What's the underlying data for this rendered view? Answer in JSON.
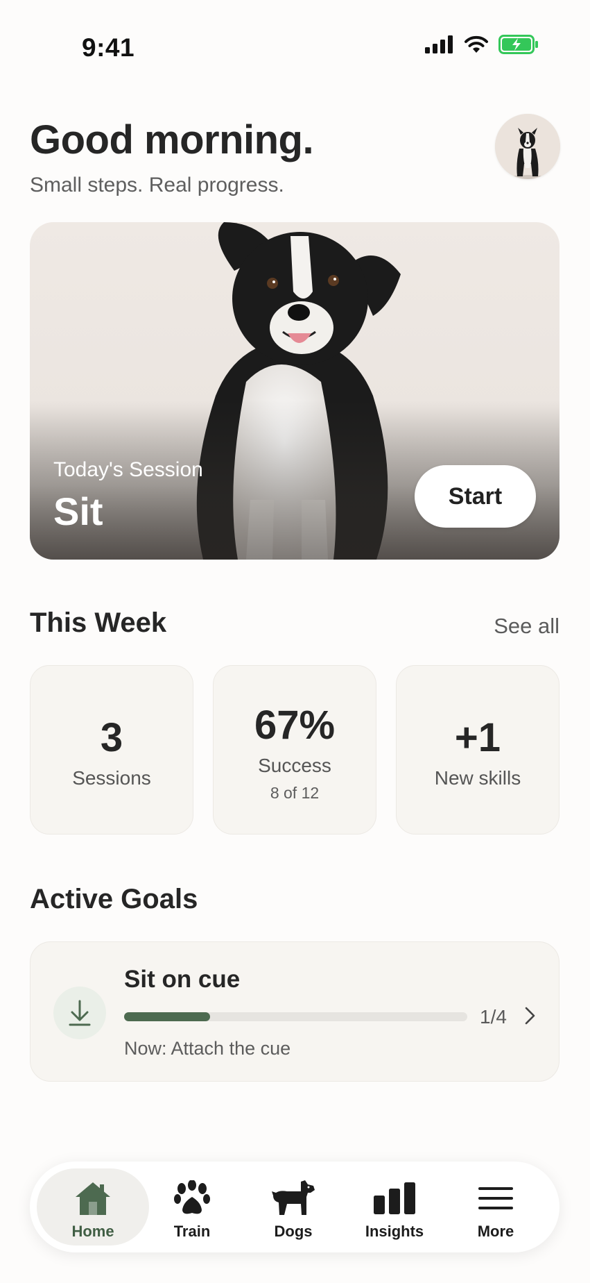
{
  "status_bar": {
    "time": "9:41"
  },
  "header": {
    "greeting": "Good morning.",
    "tagline": "Small steps. Real progress."
  },
  "hero": {
    "subtitle": "Today's Session",
    "title": "Sit",
    "start_label": "Start"
  },
  "this_week": {
    "title": "This Week",
    "see_all": "See all",
    "stats": [
      {
        "value": "3",
        "label": "Sessions"
      },
      {
        "value": "67%",
        "label": "Success",
        "detail": "8 of 12"
      },
      {
        "value": "+1",
        "label": "New skills"
      }
    ]
  },
  "active_goals": {
    "title": "Active Goals",
    "goals": [
      {
        "name": "Sit on cue",
        "progress": 0.25,
        "count": "1/4",
        "step": "Now: Attach the cue"
      }
    ]
  },
  "tabbar": {
    "items": [
      {
        "label": "Home",
        "icon": "home-icon",
        "active": true
      },
      {
        "label": "Train",
        "icon": "paw-icon"
      },
      {
        "label": "Dogs",
        "icon": "dog-icon"
      },
      {
        "label": "Insights",
        "icon": "bar-chart-icon"
      },
      {
        "label": "More",
        "icon": "menu-icon"
      }
    ]
  },
  "colors": {
    "accent": "#4d6a50",
    "background": "#fdfcfb",
    "card": "#f7f5f1",
    "battery": "#34c759"
  }
}
